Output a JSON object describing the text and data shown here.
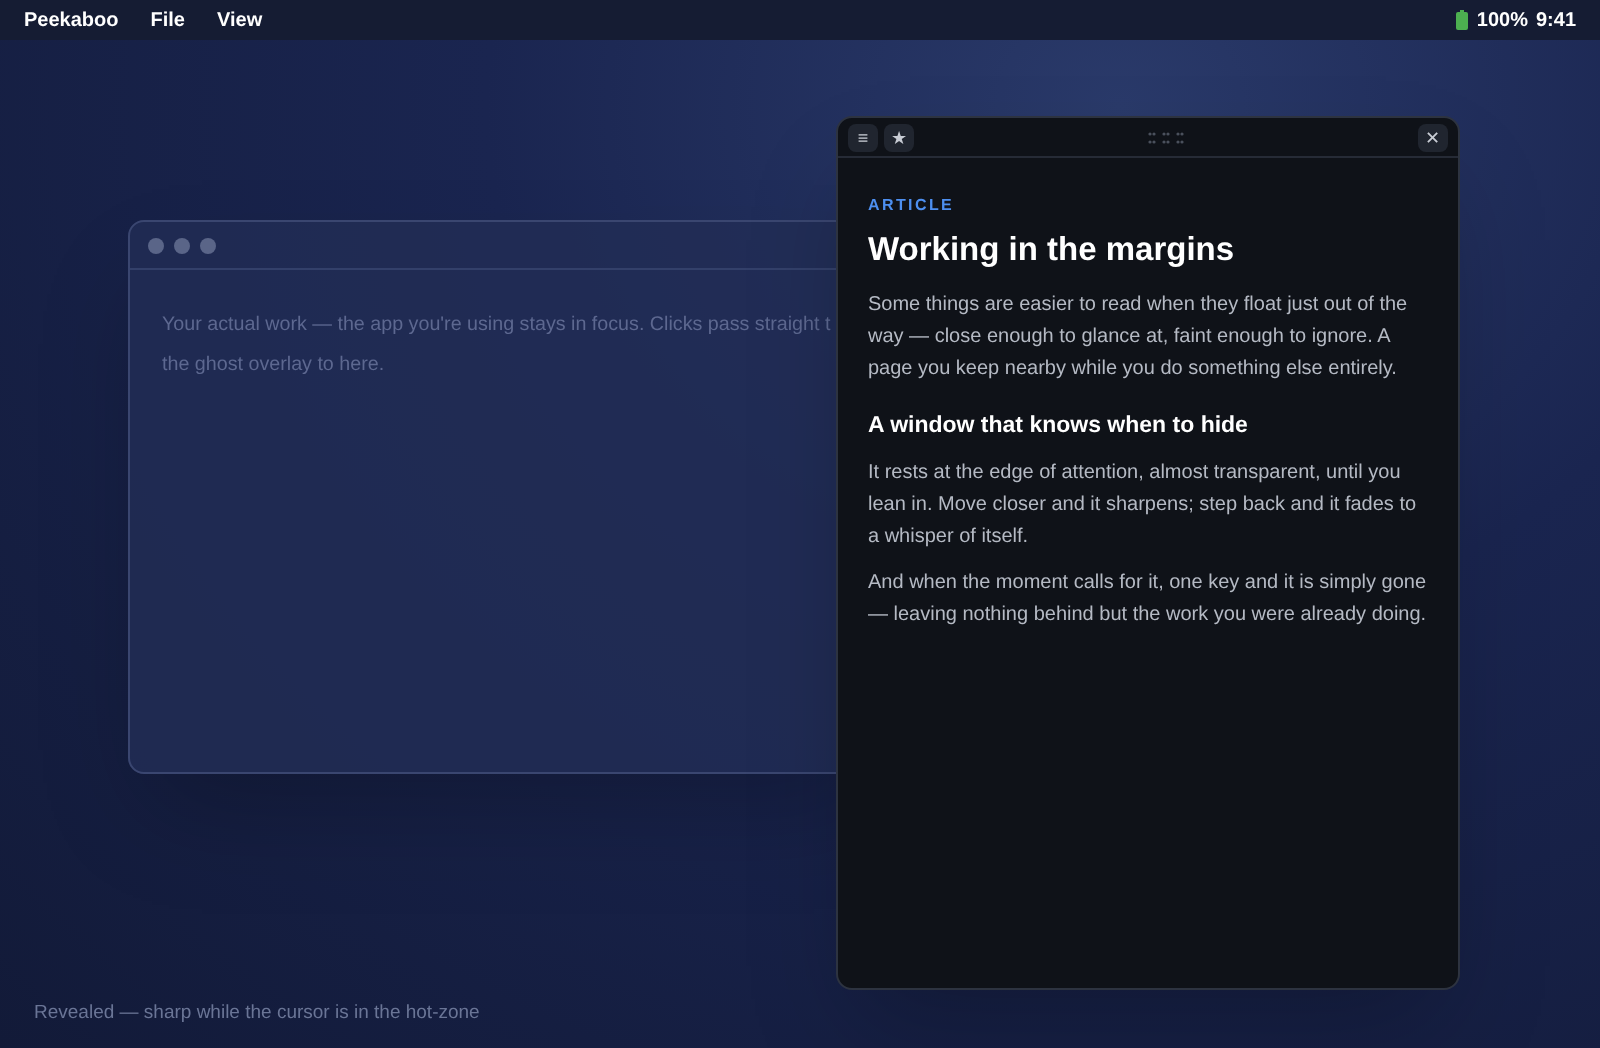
{
  "menu_bar": {
    "app_name": "Peekaboo",
    "menus": [
      "File",
      "View"
    ],
    "battery": "100%",
    "time": "9:41"
  },
  "background_window": {
    "text_lines": [
      "Your actual work — the app you're using stays in focus. Clicks pass straight t",
      "the ghost overlay to here."
    ]
  },
  "overlay": {
    "toolbar": {
      "menu_button": "≡",
      "star_button": "★",
      "close_button": "✕"
    },
    "eyebrow": "ARTICLE",
    "title": "Working in the margins",
    "blocks": [
      {
        "kind": "paragraph",
        "text": "Some things are easier to read when they float just out of the way — close enough to glance at, faint enough to ignore. A page you keep nearby while you do something else entirely."
      },
      {
        "kind": "heading",
        "text": "A window that knows when to hide"
      },
      {
        "kind": "paragraph",
        "text": "It rests at the edge of attention, almost transparent, until you lean in. Move closer and it sharpens; step back and it fades to a whisper of itself."
      },
      {
        "kind": "paragraph",
        "text": "And when the moment calls for it, one key and it is simply gone — leaving nothing behind but the work you were already doing."
      }
    ]
  },
  "status": "Revealed — sharp while the cursor is in the hot-zone"
}
